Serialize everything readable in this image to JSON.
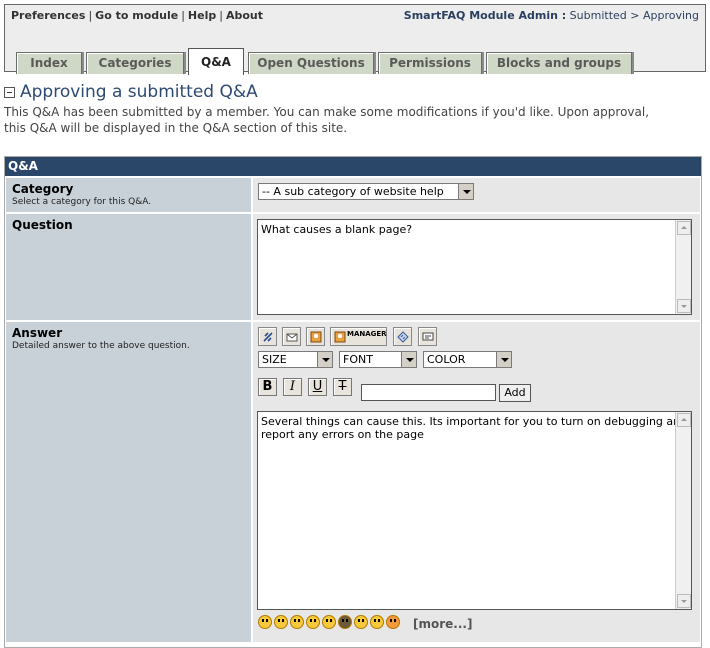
{
  "nav": {
    "links": [
      "Preferences",
      "Go to module",
      "Help",
      "About"
    ],
    "crumb_title": "SmartFAQ Module Admin :",
    "crumb_rest": "Submitted > Approving"
  },
  "tabs": [
    "Index",
    "Categories",
    "Q&A",
    "Open Questions",
    "Permissions",
    "Blocks and groups"
  ],
  "active_tab": "Q&A",
  "page": {
    "title": "Approving a submitted Q&A",
    "intro": "This Q&A has been submitted by a member. You can make some modifications if you'd like. Upon approval, this Q&A will be displayed in the Q&A section of this site."
  },
  "form": {
    "header": "Q&A",
    "category": {
      "label": "Category",
      "help": "Select a category for this Q&A.",
      "value": "-- A sub category of website help"
    },
    "question": {
      "label": "Question",
      "value": "What causes a blank page?"
    },
    "answer": {
      "label": "Answer",
      "help": "Detailed answer to the above question.",
      "manager_label": "MANAGER",
      "size": "SIZE",
      "font": "FONT",
      "color": "COLOR",
      "bold": "B",
      "italic": "I",
      "underline": "U",
      "strike": "T",
      "add_button": "Add",
      "value": "Several things can cause this. Its important for you to turn on debugging and report any errors on the page",
      "more_link": "[more...]"
    }
  },
  "colors": {
    "header_bar": "#2a4668",
    "label_bg": "#c8d0d8",
    "field_bg": "#e7e7e7",
    "tab_bg": "#cfd8c6"
  }
}
